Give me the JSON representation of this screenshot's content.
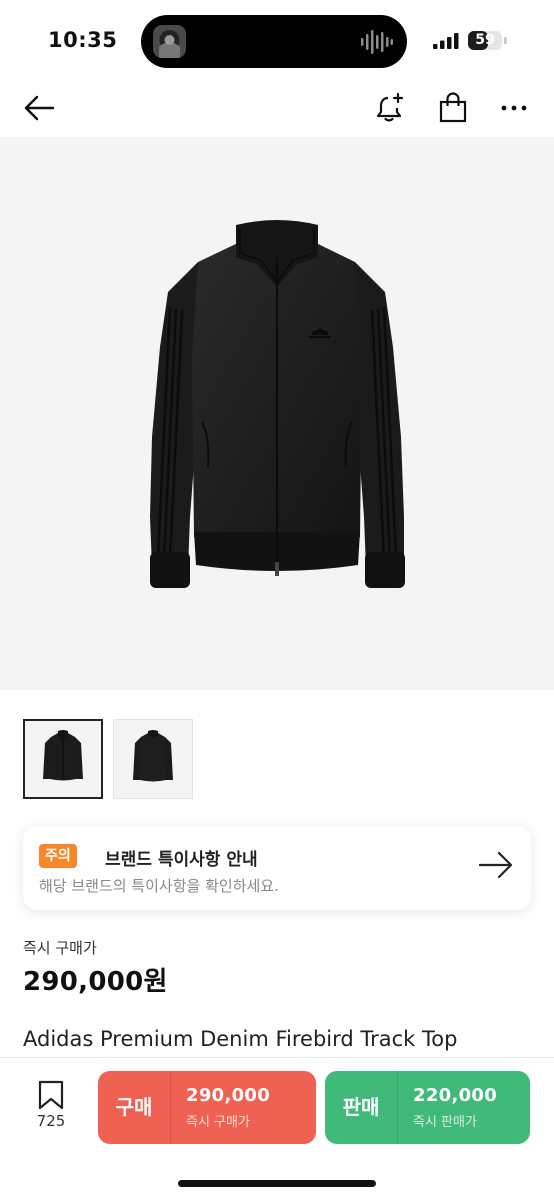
{
  "status_bar": {
    "time": "10:35",
    "battery": "59",
    "battery_level": 0.59
  },
  "nav": {
    "back_icon": "arrow-left-icon",
    "alert_icon": "bell-plus-icon",
    "cart_icon": "shopping-bag-icon",
    "more_icon": "more-horizontal-icon"
  },
  "gallery": {
    "thumbnail_count": 2,
    "selected_index": 0
  },
  "notice": {
    "badge": "주의",
    "title": "브랜드 특이사항 안내",
    "subtitle": "해당 브랜드의 특이사항을 확인하세요.",
    "badge_color": "#f6882b"
  },
  "price": {
    "label": "즉시 구매가",
    "value": "290,000원"
  },
  "product": {
    "name": "Adidas Premium Denim Firebird Track Top"
  },
  "bottom_bar": {
    "bookmark_count": "725",
    "buy": {
      "label": "구매",
      "price": "290,000",
      "sub": "즉시 구매가",
      "color": "#ef6253"
    },
    "sell": {
      "label": "판매",
      "price": "220,000",
      "sub": "즉시 판매가",
      "color": "#41b979"
    }
  }
}
